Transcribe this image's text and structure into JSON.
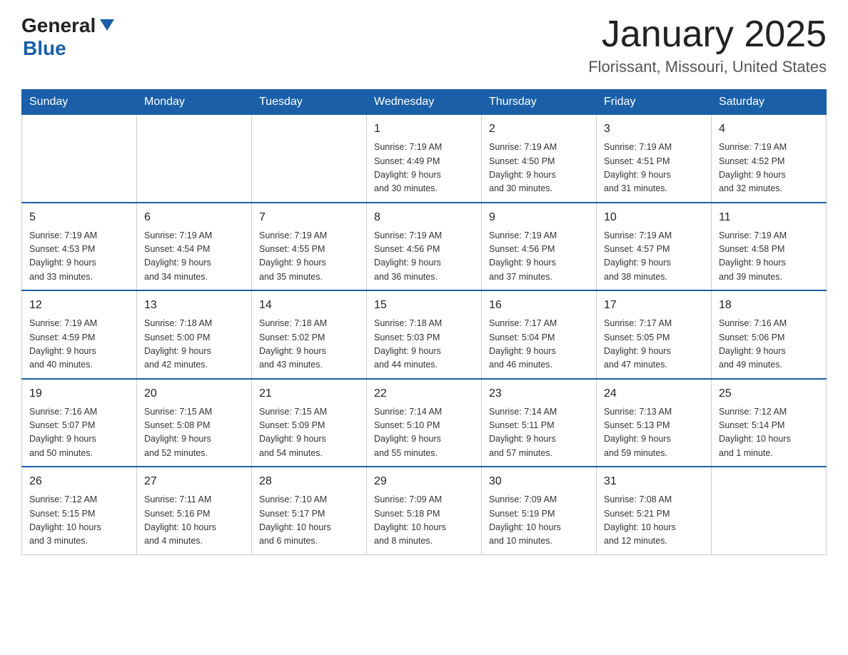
{
  "header": {
    "logo_general": "General",
    "logo_blue": "Blue",
    "month_year": "January 2025",
    "location": "Florissant, Missouri, United States"
  },
  "weekdays": [
    "Sunday",
    "Monday",
    "Tuesday",
    "Wednesday",
    "Thursday",
    "Friday",
    "Saturday"
  ],
  "weeks": [
    [
      {
        "day": "",
        "info": ""
      },
      {
        "day": "",
        "info": ""
      },
      {
        "day": "",
        "info": ""
      },
      {
        "day": "1",
        "info": "Sunrise: 7:19 AM\nSunset: 4:49 PM\nDaylight: 9 hours\nand 30 minutes."
      },
      {
        "day": "2",
        "info": "Sunrise: 7:19 AM\nSunset: 4:50 PM\nDaylight: 9 hours\nand 30 minutes."
      },
      {
        "day": "3",
        "info": "Sunrise: 7:19 AM\nSunset: 4:51 PM\nDaylight: 9 hours\nand 31 minutes."
      },
      {
        "day": "4",
        "info": "Sunrise: 7:19 AM\nSunset: 4:52 PM\nDaylight: 9 hours\nand 32 minutes."
      }
    ],
    [
      {
        "day": "5",
        "info": "Sunrise: 7:19 AM\nSunset: 4:53 PM\nDaylight: 9 hours\nand 33 minutes."
      },
      {
        "day": "6",
        "info": "Sunrise: 7:19 AM\nSunset: 4:54 PM\nDaylight: 9 hours\nand 34 minutes."
      },
      {
        "day": "7",
        "info": "Sunrise: 7:19 AM\nSunset: 4:55 PM\nDaylight: 9 hours\nand 35 minutes."
      },
      {
        "day": "8",
        "info": "Sunrise: 7:19 AM\nSunset: 4:56 PM\nDaylight: 9 hours\nand 36 minutes."
      },
      {
        "day": "9",
        "info": "Sunrise: 7:19 AM\nSunset: 4:56 PM\nDaylight: 9 hours\nand 37 minutes."
      },
      {
        "day": "10",
        "info": "Sunrise: 7:19 AM\nSunset: 4:57 PM\nDaylight: 9 hours\nand 38 minutes."
      },
      {
        "day": "11",
        "info": "Sunrise: 7:19 AM\nSunset: 4:58 PM\nDaylight: 9 hours\nand 39 minutes."
      }
    ],
    [
      {
        "day": "12",
        "info": "Sunrise: 7:19 AM\nSunset: 4:59 PM\nDaylight: 9 hours\nand 40 minutes."
      },
      {
        "day": "13",
        "info": "Sunrise: 7:18 AM\nSunset: 5:00 PM\nDaylight: 9 hours\nand 42 minutes."
      },
      {
        "day": "14",
        "info": "Sunrise: 7:18 AM\nSunset: 5:02 PM\nDaylight: 9 hours\nand 43 minutes."
      },
      {
        "day": "15",
        "info": "Sunrise: 7:18 AM\nSunset: 5:03 PM\nDaylight: 9 hours\nand 44 minutes."
      },
      {
        "day": "16",
        "info": "Sunrise: 7:17 AM\nSunset: 5:04 PM\nDaylight: 9 hours\nand 46 minutes."
      },
      {
        "day": "17",
        "info": "Sunrise: 7:17 AM\nSunset: 5:05 PM\nDaylight: 9 hours\nand 47 minutes."
      },
      {
        "day": "18",
        "info": "Sunrise: 7:16 AM\nSunset: 5:06 PM\nDaylight: 9 hours\nand 49 minutes."
      }
    ],
    [
      {
        "day": "19",
        "info": "Sunrise: 7:16 AM\nSunset: 5:07 PM\nDaylight: 9 hours\nand 50 minutes."
      },
      {
        "day": "20",
        "info": "Sunrise: 7:15 AM\nSunset: 5:08 PM\nDaylight: 9 hours\nand 52 minutes."
      },
      {
        "day": "21",
        "info": "Sunrise: 7:15 AM\nSunset: 5:09 PM\nDaylight: 9 hours\nand 54 minutes."
      },
      {
        "day": "22",
        "info": "Sunrise: 7:14 AM\nSunset: 5:10 PM\nDaylight: 9 hours\nand 55 minutes."
      },
      {
        "day": "23",
        "info": "Sunrise: 7:14 AM\nSunset: 5:11 PM\nDaylight: 9 hours\nand 57 minutes."
      },
      {
        "day": "24",
        "info": "Sunrise: 7:13 AM\nSunset: 5:13 PM\nDaylight: 9 hours\nand 59 minutes."
      },
      {
        "day": "25",
        "info": "Sunrise: 7:12 AM\nSunset: 5:14 PM\nDaylight: 10 hours\nand 1 minute."
      }
    ],
    [
      {
        "day": "26",
        "info": "Sunrise: 7:12 AM\nSunset: 5:15 PM\nDaylight: 10 hours\nand 3 minutes."
      },
      {
        "day": "27",
        "info": "Sunrise: 7:11 AM\nSunset: 5:16 PM\nDaylight: 10 hours\nand 4 minutes."
      },
      {
        "day": "28",
        "info": "Sunrise: 7:10 AM\nSunset: 5:17 PM\nDaylight: 10 hours\nand 6 minutes."
      },
      {
        "day": "29",
        "info": "Sunrise: 7:09 AM\nSunset: 5:18 PM\nDaylight: 10 hours\nand 8 minutes."
      },
      {
        "day": "30",
        "info": "Sunrise: 7:09 AM\nSunset: 5:19 PM\nDaylight: 10 hours\nand 10 minutes."
      },
      {
        "day": "31",
        "info": "Sunrise: 7:08 AM\nSunset: 5:21 PM\nDaylight: 10 hours\nand 12 minutes."
      },
      {
        "day": "",
        "info": ""
      }
    ]
  ]
}
